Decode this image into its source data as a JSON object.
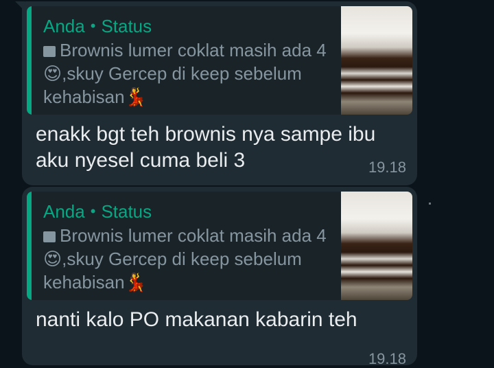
{
  "messages": [
    {
      "quote": {
        "sender": "Anda",
        "separator": "•",
        "source": "Status",
        "media_icon": "image-icon",
        "text": "Brownis lumer coklat masih ada 4😍,skuy Gercep di keep sebelum kehabisan💃"
      },
      "text": "enakk bgt teh brownis nya sampe ibu aku nyesel cuma beli 3",
      "time": "19.18"
    },
    {
      "quote": {
        "sender": "Anda",
        "separator": "•",
        "source": "Status",
        "media_icon": "image-icon",
        "text": "Brownis lumer coklat masih ada 4😍,skuy Gercep di keep sebelum kehabisan💃"
      },
      "text": "nanti kalo PO makanan kabarin teh",
      "time": "19.18"
    }
  ],
  "colors": {
    "background": "#0b141a",
    "bubble": "#202c33",
    "accent": "#06a884",
    "text": "#e9edef",
    "muted": "#8696a0"
  }
}
